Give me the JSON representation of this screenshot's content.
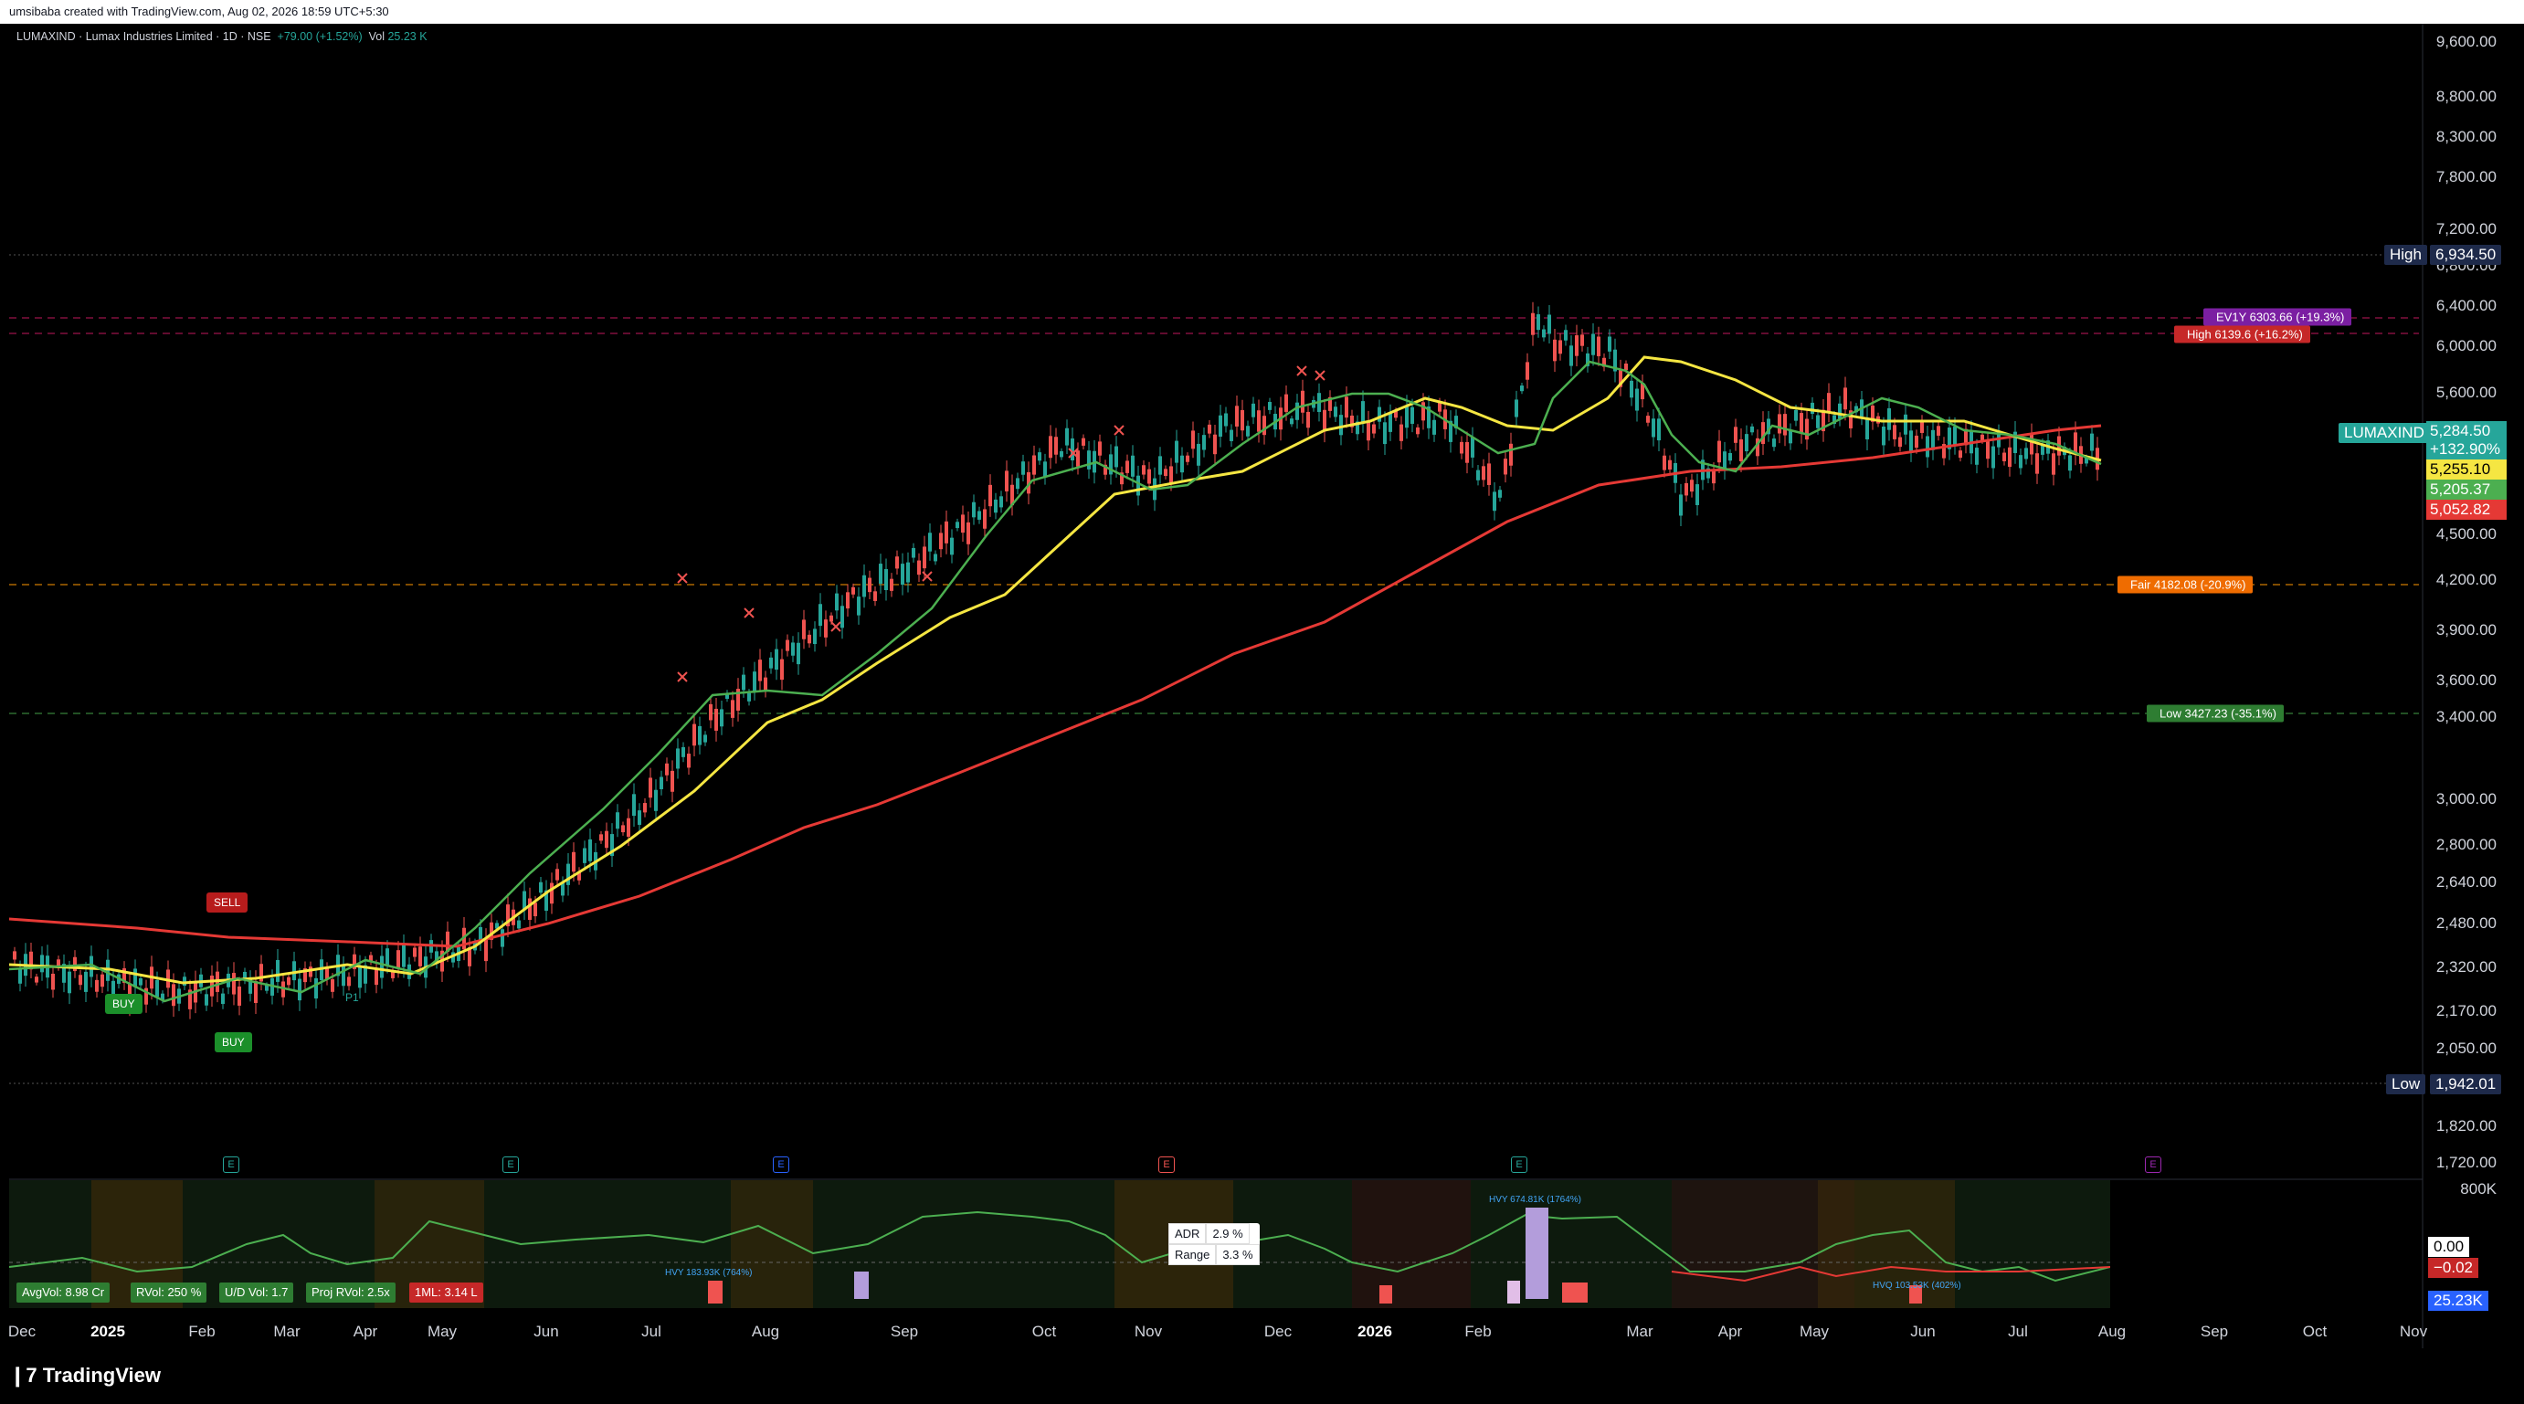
{
  "header": {
    "attribution": "umsibaba created with TradingView.com, Aug 02, 2026 18:59 UTC+5:30",
    "symbol": "LUMAXIND · Lumax Industries Limited · 1D · NSE",
    "change": "+79.00 (+1.52%)",
    "volume_label": "Vol",
    "volume_value": "25.23 K"
  },
  "price_axis": [
    "9,600.00",
    "8,800.00",
    "8,300.00",
    "7,800.00",
    "7,200.00",
    "6,800.00",
    "6,400.00",
    "6,000.00",
    "5,600.00",
    "4,500.00",
    "4,200.00",
    "3,900.00",
    "3,600.00",
    "3,400.00",
    "3,000.00",
    "2,800.00",
    "2,640.00",
    "2,480.00",
    "2,320.00",
    "2,170.00",
    "2,050.00",
    "1,820.00",
    "1,720.00"
  ],
  "price_tags": {
    "high_label": "High",
    "high_value": "6,934.50",
    "low_label": "Low",
    "low_value": "1,942.01",
    "symbol_tag": "LUMAXIND",
    "last": "5,284.50",
    "pct": "+132.90%",
    "ma_yellow": "5,255.10",
    "ma_green": "5,205.37",
    "ma_red": "5,052.82"
  },
  "levels": {
    "ev": "EV1Y 6303.66 (+19.3%)",
    "high": "High 6139.6 (+16.2%)",
    "fair": "Fair 4182.08 (-20.9%)",
    "low": "Low 3427.23 (-35.1%)"
  },
  "signals": {
    "sell": "SELL",
    "buy1": "BUY",
    "buy2": "BUY",
    "p1": "P1"
  },
  "indicator": {
    "stats": [
      "AvgVol: 8.98 Cr",
      "RVol: 250 %",
      "U/D Vol: 1.7",
      "Proj RVol: 2.5x",
      "1ML: 3.14 L"
    ],
    "adr_label": "ADR",
    "adr_value": "2.9 %",
    "range_label": "Range",
    "range_value": "3.3 %",
    "axis_top": "800K",
    "tag_zero": "0.00",
    "tag_neg": "−0.02",
    "tag_vol": "25.23K",
    "hvy1": "HVY 183.93K (764%)",
    "hvy2": "HVY 674.81K (1764%)",
    "hvy3": "HVQ 103.53K (402%)"
  },
  "time_axis": [
    "Dec",
    "2025",
    "Feb",
    "Mar",
    "Apr",
    "May",
    "Jun",
    "Jul",
    "Aug",
    "Sep",
    "Oct",
    "Nov",
    "Dec",
    "2026",
    "Feb",
    "Mar",
    "Apr",
    "May",
    "Jun",
    "Jul",
    "Aug",
    "Sep",
    "Oct",
    "Nov"
  ],
  "earnings_badge": "E",
  "logo": "TradingView",
  "colors": {
    "up": "#26a69a",
    "down": "#ef5350",
    "ma_yellow": "#f5e642",
    "ma_green": "#4caf50",
    "ma_red": "#e53935",
    "tag_blue": "#2962ff"
  }
}
